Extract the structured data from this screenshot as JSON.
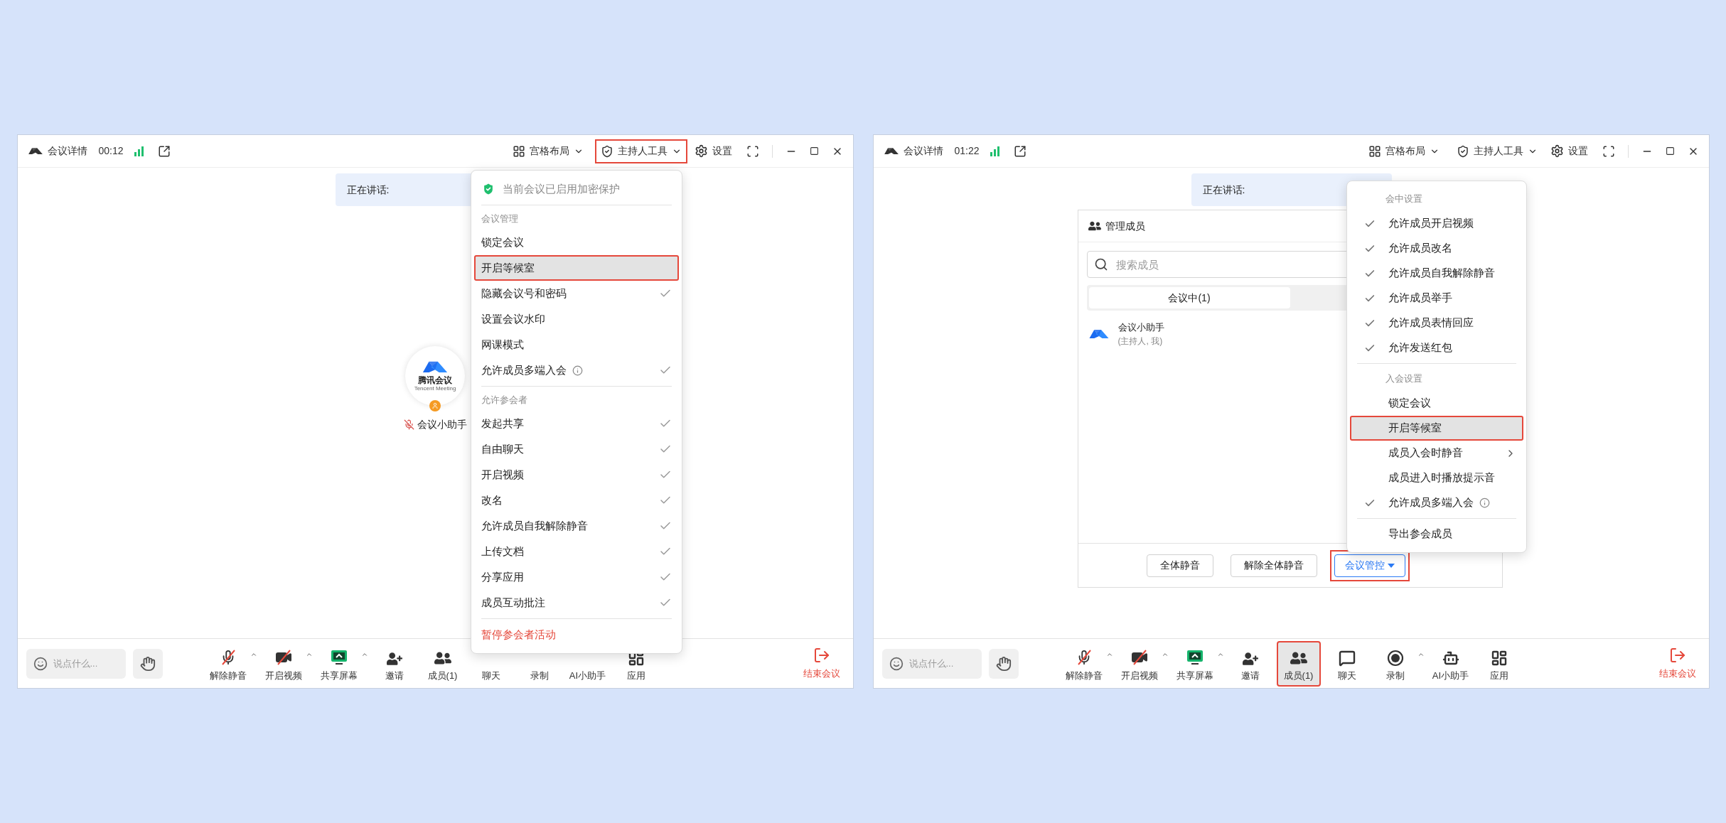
{
  "windows": [
    {
      "title_bar": {
        "title": "会议详情",
        "timer": "00:12",
        "layout_button": "宫格布局",
        "host_tools": {
          "label": "主持人工具",
          "highlighted": true
        },
        "settings_button": "设置"
      },
      "speaking_banner": "正在讲话:",
      "stage": {
        "kind": "video",
        "logo_text": "腾讯会议",
        "logo_subtext": "Tencent Meeting",
        "name": "会议小助手",
        "muted": true
      },
      "menu": {
        "kind": "host-tools",
        "items": [
          {
            "kind": "notice",
            "label": "当前会议已启用加密保护"
          },
          {
            "kind": "divider"
          },
          {
            "kind": "section",
            "label": "会议管理"
          },
          {
            "kind": "item",
            "label": "锁定会议",
            "checked": false,
            "selected": false,
            "highlighted": false
          },
          {
            "kind": "item",
            "label": "开启等候室",
            "checked": false,
            "selected": true,
            "highlighted": true
          },
          {
            "kind": "item",
            "label": "隐藏会议号和密码",
            "checked": true,
            "selected": false,
            "highlighted": false
          },
          {
            "kind": "item",
            "label": "设置会议水印",
            "checked": false,
            "selected": false,
            "highlighted": false
          },
          {
            "kind": "item",
            "label": "网课模式",
            "checked": false,
            "selected": false,
            "highlighted": false
          },
          {
            "kind": "item",
            "label": "允许成员多端入会",
            "checked": true,
            "selected": false,
            "highlighted": false,
            "info": true
          },
          {
            "kind": "divider"
          },
          {
            "kind": "section",
            "label": "允许参会者"
          },
          {
            "kind": "item",
            "label": "发起共享",
            "checked": true,
            "selected": false,
            "highlighted": false
          },
          {
            "kind": "item",
            "label": "自由聊天",
            "checked": true,
            "selected": false,
            "highlighted": false
          },
          {
            "kind": "item",
            "label": "开启视频",
            "checked": true,
            "selected": false,
            "highlighted": false
          },
          {
            "kind": "item",
            "label": "改名",
            "checked": true,
            "selected": false,
            "highlighted": false
          },
          {
            "kind": "item",
            "label": "允许成员自我解除静音",
            "checked": true,
            "selected": false,
            "highlighted": false
          },
          {
            "kind": "item",
            "label": "上传文档",
            "checked": true,
            "selected": false,
            "highlighted": false
          },
          {
            "kind": "item",
            "label": "分享应用",
            "checked": true,
            "selected": false,
            "highlighted": false
          },
          {
            "kind": "item",
            "label": "成员互动批注",
            "checked": true,
            "selected": false,
            "highlighted": false
          },
          {
            "kind": "divider"
          },
          {
            "kind": "danger",
            "label": "暂停参会者活动"
          }
        ]
      },
      "toolbar": {
        "chat_placeholder": "说点什么...",
        "items": [
          {
            "kind": "mic",
            "label": "解除静音",
            "caret": true,
            "selected": false,
            "highlighted": false
          },
          {
            "kind": "video",
            "label": "开启视频",
            "caret": true,
            "selected": false,
            "highlighted": false
          },
          {
            "kind": "share",
            "label": "共享屏幕",
            "caret": true,
            "selected": false,
            "highlighted": false
          },
          {
            "kind": "invite",
            "label": "邀请",
            "caret": false,
            "selected": false,
            "highlighted": false
          },
          {
            "kind": "members",
            "label": "成员(1)",
            "caret": false,
            "selected": false,
            "highlighted": false
          },
          {
            "label": "聊天",
            "caret": false,
            "selected": false,
            "highlighted": false
          },
          {
            "label": "录制",
            "caret": false,
            "selected": false,
            "highlighted": false
          },
          {
            "label": "AI小助手",
            "caret": false,
            "selected": false,
            "highlighted": false
          },
          {
            "kind": "apps",
            "label": "应用",
            "caret": false,
            "selected": false,
            "highlighted": false
          }
        ],
        "end_button": "结束会议"
      }
    },
    {
      "title_bar": {
        "title": "会议详情",
        "timer": "01:22",
        "layout_button": "宫格布局",
        "host_tools": {
          "label": "主持人工具",
          "highlighted": false
        },
        "settings_button": "设置"
      },
      "speaking_banner": "正在讲话:",
      "stage": {
        "kind": "members",
        "title": "管理成员",
        "search_placeholder": "搜索成员",
        "tabs": [
          {
            "label": "会议中(1)",
            "selected": true
          }
        ],
        "members": [
          {
            "name": "会议小助手",
            "role": "(主持人, 我)"
          }
        ],
        "buttons": [
          {
            "kind": "plain",
            "label": "全体静音",
            "highlighted": false
          },
          {
            "kind": "plain",
            "label": "解除全体静音",
            "highlighted": false
          },
          {
            "kind": "dropdown",
            "label": "会议管控",
            "highlighted": true
          }
        ]
      },
      "menu": {
        "kind": "meeting-control",
        "items": [
          {
            "kind": "section",
            "label": "会中设置"
          },
          {
            "kind": "item",
            "label": "允许成员开启视频",
            "checked": true,
            "selected": false,
            "highlighted": false
          },
          {
            "kind": "item",
            "label": "允许成员改名",
            "checked": true,
            "selected": false,
            "highlighted": false
          },
          {
            "kind": "item",
            "label": "允许成员自我解除静音",
            "checked": true,
            "selected": false,
            "highlighted": false
          },
          {
            "kind": "item",
            "label": "允许成员举手",
            "checked": true,
            "selected": false,
            "highlighted": false
          },
          {
            "kind": "item",
            "label": "允许成员表情回应",
            "checked": true,
            "selected": false,
            "highlighted": false
          },
          {
            "kind": "item",
            "label": "允许发送红包",
            "checked": true,
            "selected": false,
            "highlighted": false
          },
          {
            "kind": "divider"
          },
          {
            "kind": "section",
            "label": "入会设置"
          },
          {
            "kind": "item",
            "label": "锁定会议",
            "checked": false,
            "selected": false,
            "highlighted": false
          },
          {
            "kind": "item",
            "label": "开启等候室",
            "checked": false,
            "selected": true,
            "highlighted": true
          },
          {
            "kind": "item",
            "label": "成员入会时静音",
            "checked": false,
            "selected": false,
            "highlighted": false,
            "submenu": true
          },
          {
            "kind": "item",
            "label": "成员进入时播放提示音",
            "checked": false,
            "selected": false,
            "highlighted": false
          },
          {
            "kind": "item",
            "label": "允许成员多端入会",
            "checked": true,
            "selected": false,
            "highlighted": false,
            "info": true
          },
          {
            "kind": "divider"
          },
          {
            "kind": "item",
            "label": "导出参会成员",
            "checked": false,
            "selected": false,
            "highlighted": false
          }
        ]
      },
      "toolbar": {
        "chat_placeholder": "说点什么...",
        "items": [
          {
            "kind": "mic",
            "label": "解除静音",
            "caret": true,
            "selected": false,
            "highlighted": false
          },
          {
            "kind": "video",
            "label": "开启视频",
            "caret": true,
            "selected": false,
            "highlighted": false
          },
          {
            "kind": "share",
            "label": "共享屏幕",
            "caret": true,
            "selected": false,
            "highlighted": false
          },
          {
            "kind": "invite",
            "label": "邀请",
            "caret": false,
            "selected": false,
            "highlighted": false
          },
          {
            "kind": "members",
            "label": "成员(1)",
            "caret": false,
            "selected": true,
            "highlighted": true
          },
          {
            "kind": "chat",
            "label": "聊天",
            "caret": false,
            "selected": false,
            "highlighted": false
          },
          {
            "kind": "record",
            "label": "录制",
            "caret": true,
            "selected": false,
            "highlighted": false
          },
          {
            "kind": "ai",
            "label": "AI小助手",
            "caret": false,
            "selected": false,
            "highlighted": false
          },
          {
            "kind": "apps",
            "label": "应用",
            "caret": false,
            "selected": false,
            "highlighted": false
          }
        ],
        "end_button": "结束会议"
      }
    }
  ]
}
